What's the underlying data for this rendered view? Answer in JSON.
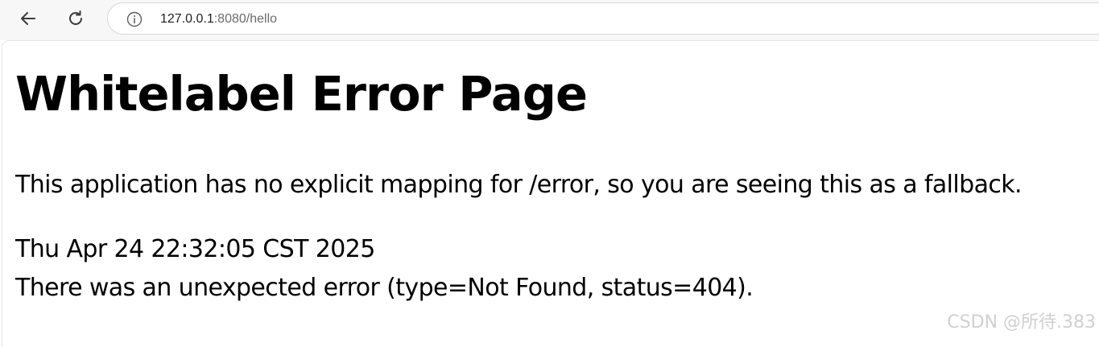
{
  "browser": {
    "address_bar": {
      "host": "127.0.0.1",
      "path": ":8080/hello"
    }
  },
  "page": {
    "title": "Whitelabel Error Page",
    "explanation": "This application has no explicit mapping for /error, so you are seeing this as a fallback.",
    "timestamp": "Thu Apr 24 22:32:05 CST 2025",
    "error_message": "There was an unexpected error (type=Not Found, status=404)."
  },
  "watermark": "CSDN @所待.383",
  "icons": {
    "back": "arrow-left-icon",
    "reload": "reload-icon",
    "site_info": "info-icon"
  },
  "colors": {
    "toolbar_bg": "#f7f7f7",
    "url_host": "#1f1f1f",
    "url_path": "#6b6b6b",
    "text": "#000000",
    "watermark": "#d0d0d0"
  }
}
